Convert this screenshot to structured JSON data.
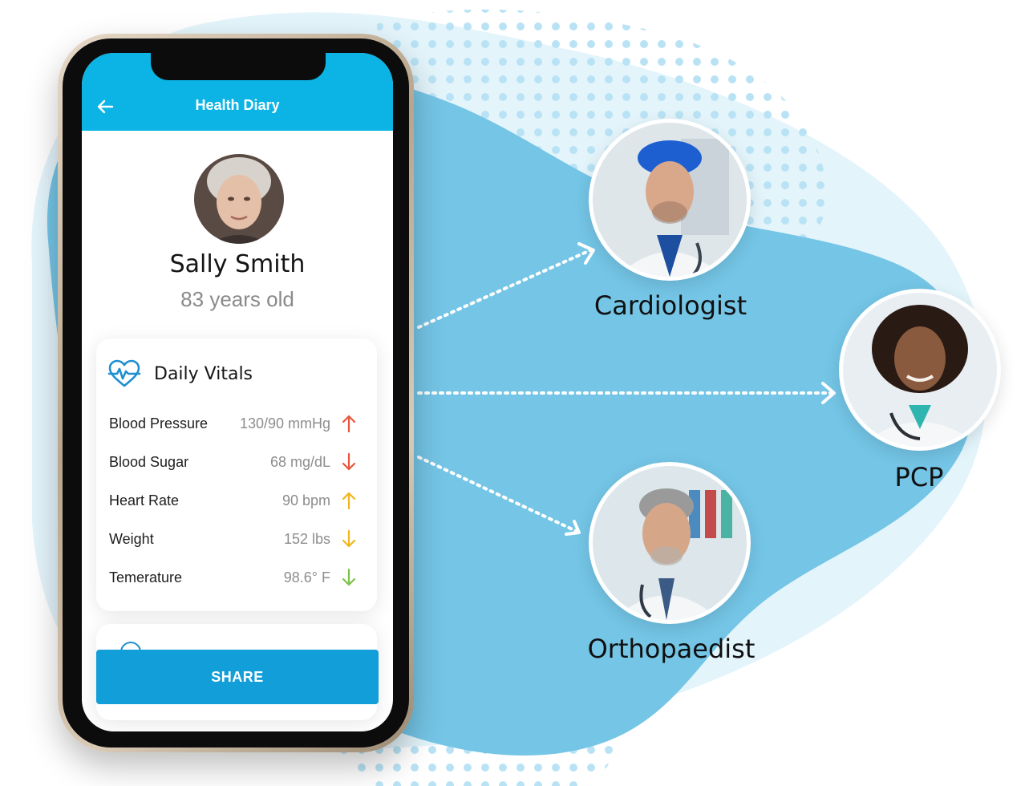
{
  "app": {
    "header_title": "Health Diary",
    "back_icon": "back-arrow-icon",
    "header_color": "#0bb4e4"
  },
  "patient": {
    "name": "Sally Smith",
    "age_text": "83 years old"
  },
  "vitals": {
    "title": "Daily Vitals",
    "icon": "heartbeat-icon",
    "rows": [
      {
        "label": "Blood Pressure",
        "value": "130/90 mmHg",
        "trend": "up",
        "color": "#e8553d"
      },
      {
        "label": "Blood Sugar",
        "value": "68 mg/dL",
        "trend": "down",
        "color": "#e8553d"
      },
      {
        "label": "Heart Rate",
        "value": "90 bpm",
        "trend": "up",
        "color": "#f2b41b"
      },
      {
        "label": "Weight",
        "value": "152 lbs",
        "trend": "down",
        "color": "#f2b41b"
      },
      {
        "label": "Temerature",
        "value": "98.6° F",
        "trend": "down",
        "color": "#7dc24b"
      }
    ]
  },
  "share_label": "SHARE",
  "doctors": {
    "cardiologist": "Cardiologist",
    "pcp": "PCP",
    "orthopaedist": "Orthopaedist"
  },
  "colors": {
    "blob": "#74c5e6",
    "dots": "#b9e3f5",
    "button": "#119ed9"
  }
}
